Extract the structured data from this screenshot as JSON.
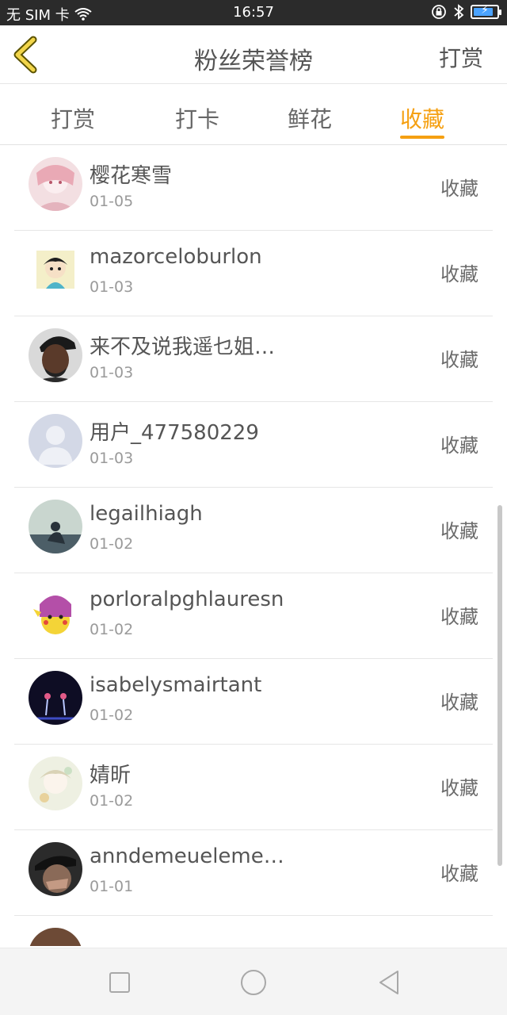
{
  "status_bar": {
    "carrier": "无 SIM 卡",
    "time": "16:57",
    "battery_level": 0.85,
    "icons": [
      "wifi-icon",
      "lock-rotation-icon",
      "bluetooth-icon",
      "battery-charging-icon"
    ]
  },
  "header": {
    "title": "粉丝荣誉榜",
    "action": "打赏",
    "back_icon": "chevron-left-icon"
  },
  "tabs": {
    "items": [
      "打赏",
      "打卡",
      "鲜花",
      "收藏"
    ],
    "active_index": 3
  },
  "colors": {
    "accent": "#f5a012",
    "text": "#555555",
    "date": "#9a9a9a",
    "divider": "#e6e6e6"
  },
  "list": {
    "rows": [
      {
        "name": "樱花寒雪",
        "date": "01-05",
        "action": "收藏"
      },
      {
        "name": "mazorceloburlon",
        "date": "01-03",
        "action": "收藏"
      },
      {
        "name": "来不及说我遥乜姐…",
        "date": "01-03",
        "action": "收藏"
      },
      {
        "name": "用户_477580229",
        "date": "01-03",
        "action": "收藏"
      },
      {
        "name": "legailhiagh",
        "date": "01-02",
        "action": "收藏"
      },
      {
        "name": "porloralpghlauresn",
        "date": "01-02",
        "action": "收藏"
      },
      {
        "name": "isabelysmairtant",
        "date": "01-02",
        "action": "收藏"
      },
      {
        "name": "婧昕",
        "date": "01-02",
        "action": "收藏"
      },
      {
        "name": "anndemeuelemee…",
        "date": "01-01",
        "action": "收藏"
      },
      {
        "name": "",
        "date": "",
        "action": ""
      }
    ]
  },
  "nav_bar": {
    "icons": [
      "square-icon",
      "circle-icon",
      "triangle-back-icon"
    ]
  }
}
